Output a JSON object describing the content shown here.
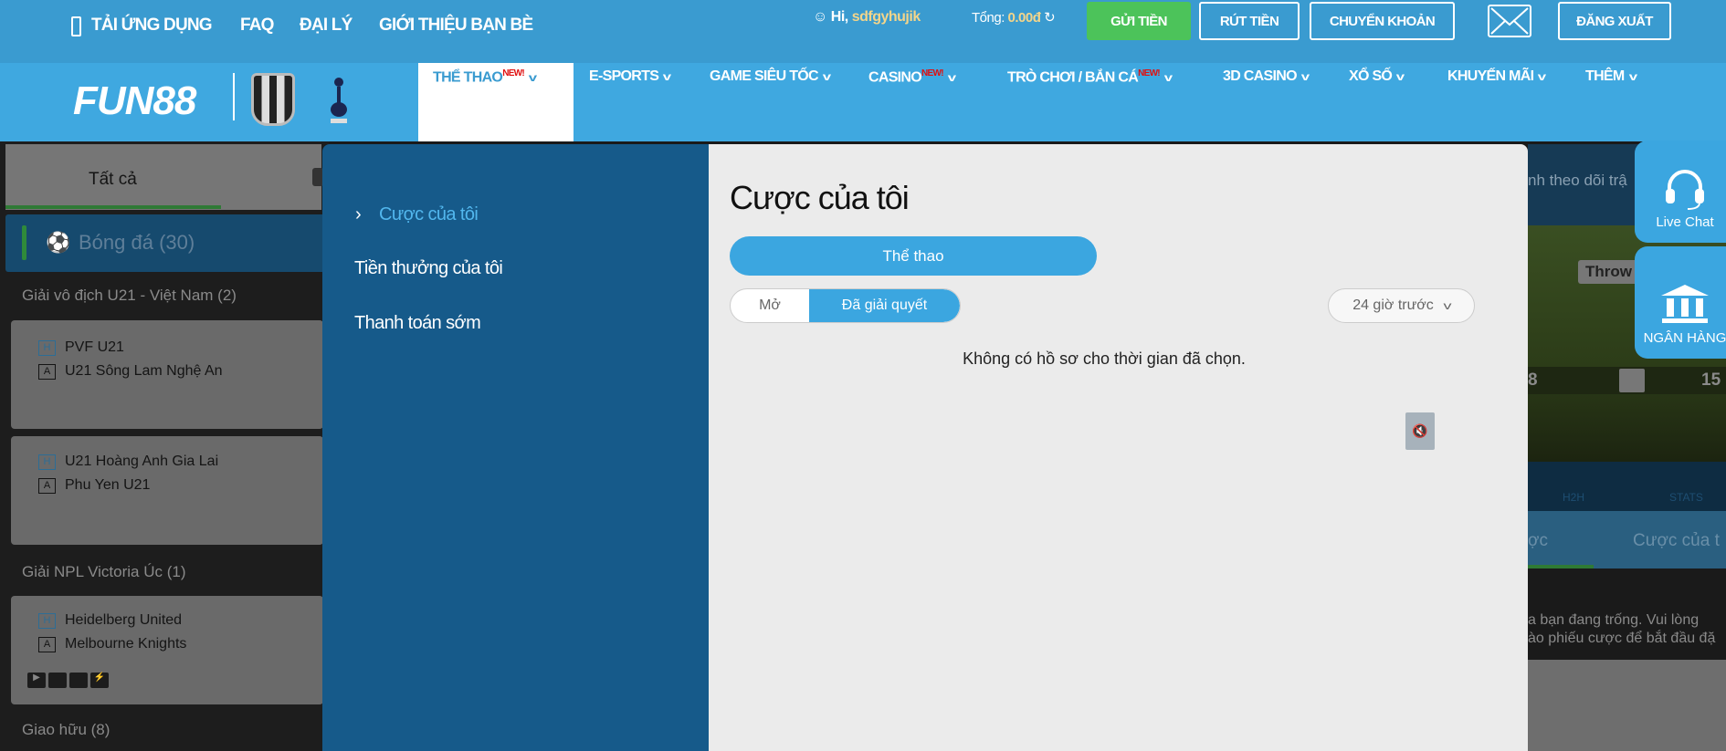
{
  "topbar": {
    "links": [
      "TẢI ỨNG DỤNG",
      "FAQ",
      "ĐẠI LÝ",
      "GIỚI THIỆU BẠN BÈ"
    ],
    "greeting": "Hi,",
    "username": "sdfgyhujik",
    "balance_label": "Tổng:",
    "balance_value": "0.00đ",
    "deposit": "GỬI TIỀN",
    "withdraw": "RÚT TIỀN",
    "transfer": "CHUYỂN KHOẢN",
    "logout": "ĐĂNG XUẤT",
    "deposit_color": "#4cc35a"
  },
  "nav": {
    "logo": "FUN88",
    "items": [
      {
        "label": "THỂ THAO",
        "badge": "NEW!"
      },
      {
        "label": "E-SPORTS"
      },
      {
        "label": "GAME SIÊU TỐC"
      },
      {
        "label": "CASINO",
        "badge": "NEW!"
      },
      {
        "label": "TRÒ CHƠI / BẮN CÁ",
        "badge": "NEW!"
      },
      {
        "label": "3D CASINO"
      },
      {
        "label": "XỔ SỐ"
      },
      {
        "label": "KHUYẾN MÃI"
      },
      {
        "label": "THÊM"
      }
    ]
  },
  "sidebar": {
    "tab": "Tất cả",
    "sport": "Bóng đá (30)",
    "leagues": [
      {
        "name": "Giải vô địch U21 - Việt Nam (2)",
        "matches": [
          {
            "home": "PVF U21",
            "away": "U21 Sông Lam Nghệ An"
          },
          {
            "home": "U21 Hoàng Anh Gia Lai",
            "away": "Phu Yen U21"
          }
        ]
      },
      {
        "name": "Giải NPL Victoria Úc (1)",
        "matches": [
          {
            "home": "Heidelberg United",
            "away": "Melbourne Knights"
          }
        ]
      },
      {
        "name": "Giao hữu (8)"
      }
    ],
    "home_badge": "H",
    "away_badge": "A"
  },
  "background_right": {
    "header_text": "nh theo dõi trậ",
    "field_label": "Throw",
    "score_left": "8",
    "score_right": "15",
    "tabs": [
      "H2H",
      "STATS"
    ],
    "bet_tabs": [
      "ợc",
      "Cược của t"
    ],
    "empty_line1": "a bạn đang trống. Vui lòng",
    "empty_line2": "ào phiếu cược để bắt đầu đặ"
  },
  "widgets": {
    "live_chat": "Live Chat",
    "bank": "NGÂN HÀNG"
  },
  "modal": {
    "menu": [
      "Cược của tôi",
      "Tiền thưởng của tôi",
      "Thanh toán sớm"
    ],
    "title": "Cược của tôi",
    "category": "Thể thao",
    "status_tabs": [
      "Mở",
      "Đã giải quyết"
    ],
    "period": "24 giờ trước",
    "empty_message": "Không có hồ sơ cho thời gian đã chọn.",
    "accent": "#3ba6e0"
  }
}
